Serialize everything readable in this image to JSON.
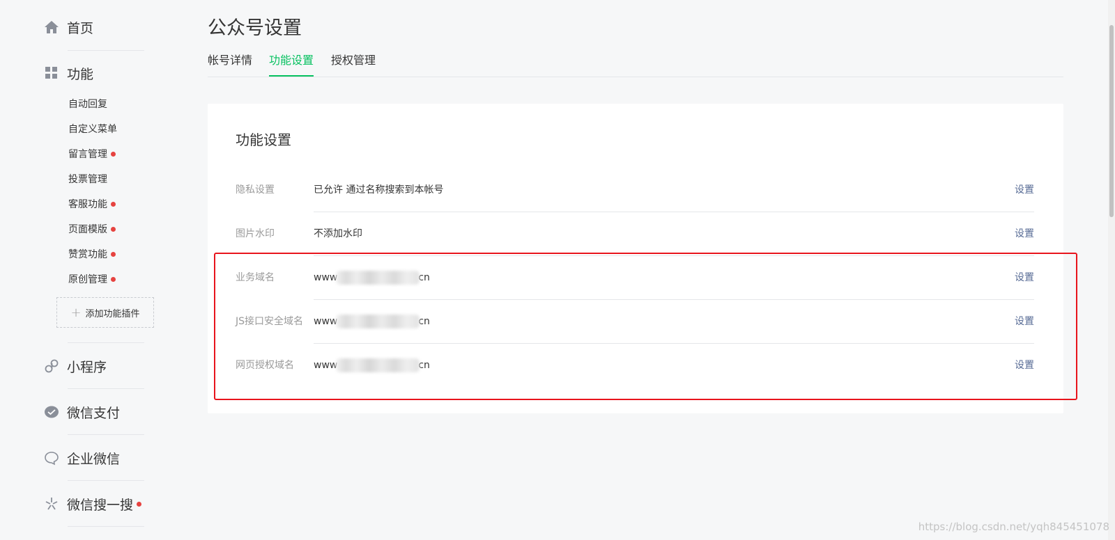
{
  "sidebar": {
    "home": {
      "label": "首页",
      "icon": "home-icon"
    },
    "function": {
      "label": "功能",
      "icon": "grid-icon",
      "items": [
        {
          "label": "自动回复",
          "dot": false
        },
        {
          "label": "自定义菜单",
          "dot": false
        },
        {
          "label": "留言管理",
          "dot": true
        },
        {
          "label": "投票管理",
          "dot": false
        },
        {
          "label": "客服功能",
          "dot": true
        },
        {
          "label": "页面模版",
          "dot": true
        },
        {
          "label": "赞赏功能",
          "dot": true
        },
        {
          "label": "原创管理",
          "dot": true
        }
      ],
      "add_plugin": "添加功能插件"
    },
    "miniprogram": {
      "label": "小程序",
      "icon": "link-icon"
    },
    "wechat_pay": {
      "label": "微信支付",
      "icon": "pay-icon"
    },
    "work_wechat": {
      "label": "企业微信",
      "icon": "chat-bubble-icon"
    },
    "wechat_search": {
      "label": "微信搜一搜",
      "icon": "search-sparkle-icon",
      "dot": true
    }
  },
  "header": {
    "title": "公众号设置",
    "tabs": [
      {
        "label": "帐号详情",
        "active": false
      },
      {
        "label": "功能设置",
        "active": true
      },
      {
        "label": "授权管理",
        "active": false
      }
    ]
  },
  "card": {
    "title": "功能设置",
    "rows": [
      {
        "label": "隐私设置",
        "value": "已允许 通过名称搜索到本帐号",
        "action": "设置"
      },
      {
        "label": "图片水印",
        "value": "不添加水印",
        "action": "设置"
      },
      {
        "label": "业务域名",
        "value_prefix": "www",
        "value_suffix": "cn",
        "action": "设置"
      },
      {
        "label": "JS接口安全域名",
        "value_prefix": "www",
        "value_suffix": "cn",
        "action": "设置"
      },
      {
        "label": "网页授权域名",
        "value_prefix": "www",
        "value_suffix": "cn",
        "action": "设置"
      }
    ]
  },
  "watermark": "https://blog.csdn.net/yqh845451078",
  "colors": {
    "accent_green": "#07c160",
    "link_blue": "#576b95",
    "alert_red": "#e64340",
    "highlight_red": "#e8141c"
  }
}
